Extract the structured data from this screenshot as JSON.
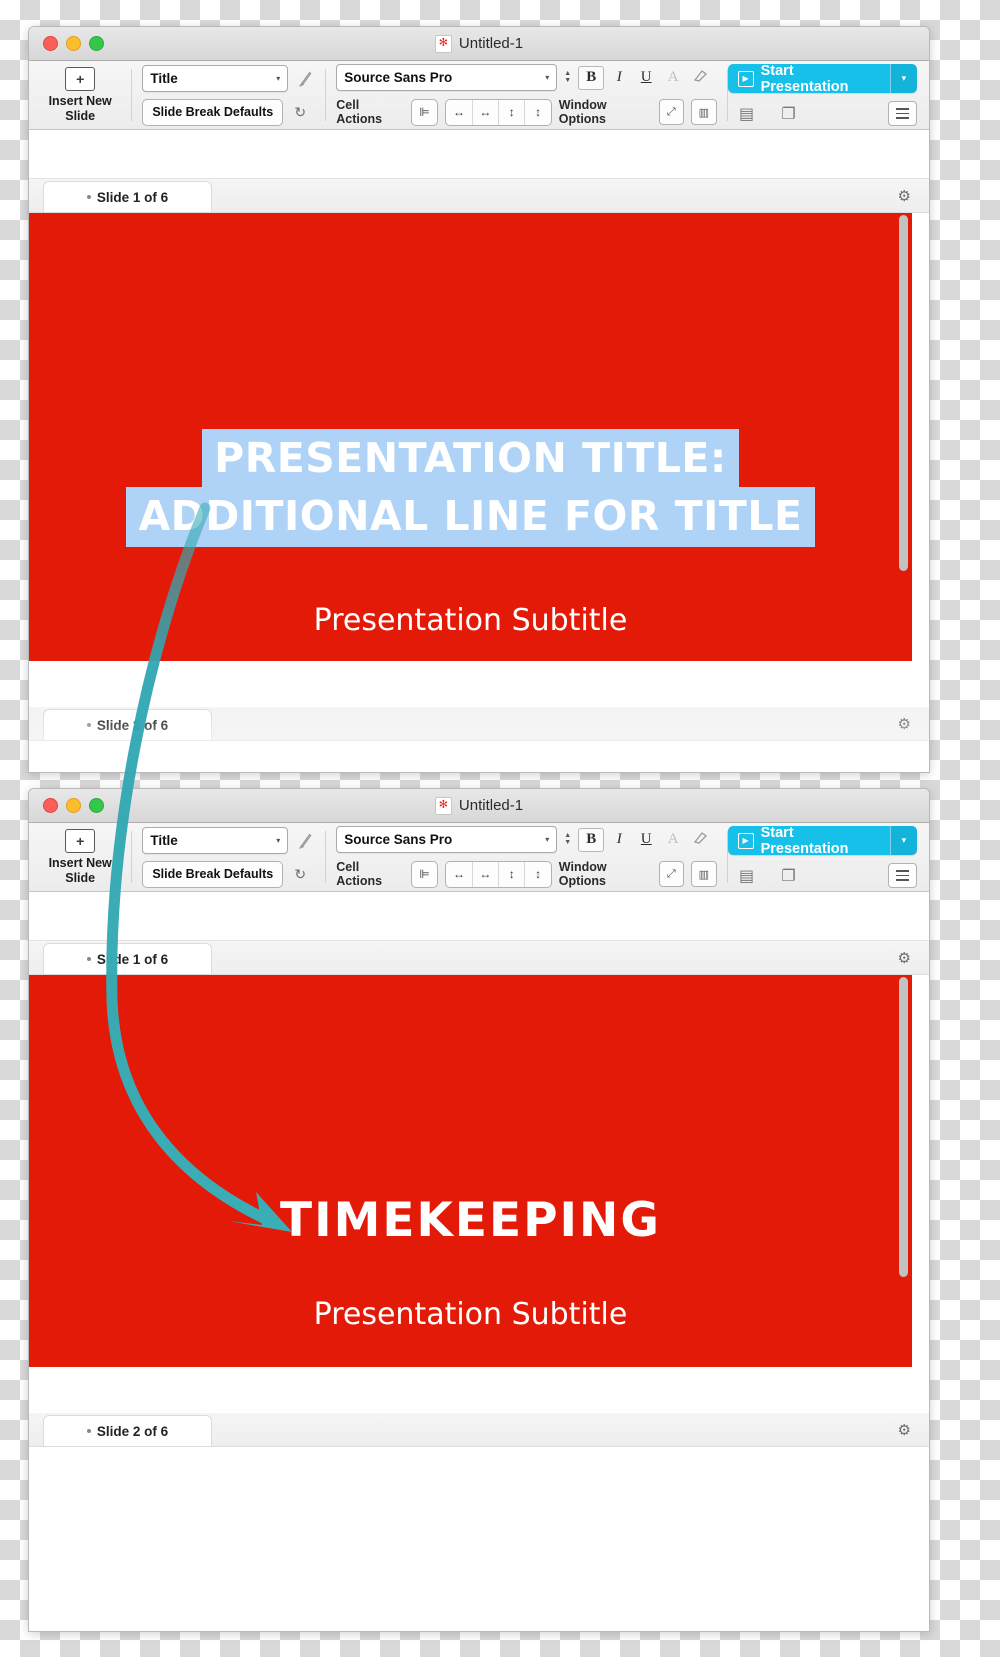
{
  "app": {
    "window_title": "Untitled-1",
    "app_icon": "flower-icon"
  },
  "toolbar": {
    "insert_new_slide_line1": "Insert New",
    "insert_new_slide_line2": "Slide",
    "insert_icon": "plus-in-box-icon",
    "style_combo_value": "Title",
    "style_combo_caret": "▾",
    "paint_icon": "style-brush-icon",
    "slide_break_defaults_label": "Slide Break Defaults",
    "reset_icon": "reset-circular-arrow-icon",
    "font_combo_value": "Source Sans Pro",
    "font_combo_caret": "▾",
    "font_size_stepper_up": "▲",
    "font_size_stepper_down": "▼",
    "bold_label": "B",
    "italic_label": "I",
    "underline_label": "U",
    "text_color_label": "A",
    "clear_format_icon": "eraser-icon",
    "cell_actions_label": "Cell Actions",
    "cell_align_icon": "align-icon",
    "cell_left_icon": "↔",
    "cell_right_icon": "↔",
    "cell_up_icon": "↕",
    "cell_down_icon": "↕",
    "window_options_label": "Window Options",
    "fullscreen_icon": "expand-icon",
    "split_view_icon": "split-pane-icon",
    "start_presentation_label": "Start Presentation",
    "start_presentation_play_icon": "play-in-box-icon",
    "start_presentation_caret": "▾",
    "calculator_icon": "keypad-icon",
    "copy_icon": "duplicate-icon",
    "menu_icon": "hamburger-menu-icon"
  },
  "windows": [
    {
      "id": "window-1",
      "tab_top_label": "Slide 1 of 6",
      "tab_bottom_label": "Slide 2 of 6",
      "gear_icon": "gear-icon",
      "slide": {
        "kind": "title-slide",
        "background_color": "#e31a08",
        "highlight_color": "#aed3f7",
        "title_lines": [
          "PRESENTATION TITLE:",
          "ADDITIONAL LINE FOR TITLE"
        ],
        "subtitle": "Presentation Subtitle"
      }
    },
    {
      "id": "window-2",
      "tab_top_label": "Slide 1 of 6",
      "tab_bottom_label": "Slide 2 of 6",
      "gear_icon": "gear-icon",
      "slide": {
        "kind": "section-slide",
        "background_color": "#e31a08",
        "big_title": "TIMEKEEPING",
        "subtitle": "Presentation Subtitle"
      }
    }
  ],
  "annotation": {
    "arrow_color": "#35aab4",
    "description": "curved-arrow-from-title-to-timekeeping"
  },
  "colors": {
    "accent_cyan": "#16c0e8",
    "slide_red": "#e31a08",
    "title_highlight_blue": "#aed3f7",
    "arrow_teal": "#35aab4"
  }
}
